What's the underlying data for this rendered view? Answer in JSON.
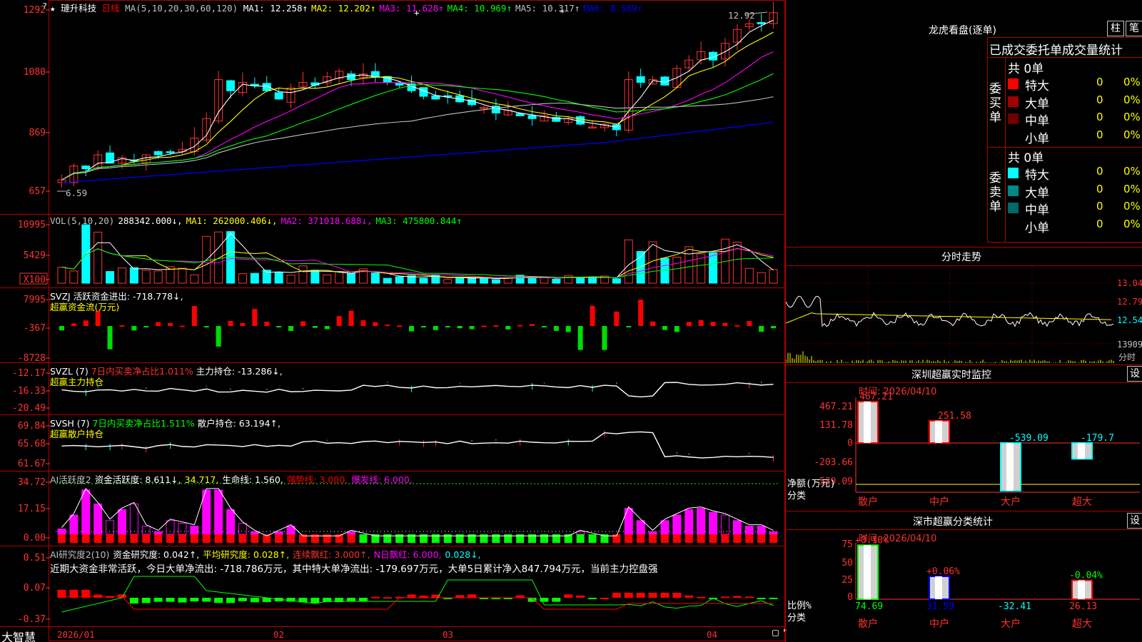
{
  "stock": {
    "star": "★",
    "name": "璉升科技",
    "period": "日线"
  },
  "main_header": {
    "ma_params": "MA(5,10,20,30,60,120)",
    "items": [
      {
        "label": "MA1: 12.258",
        "arrow": "↑",
        "color": "#ffffff"
      },
      {
        "label": "MA2: 12.202",
        "arrow": "↑",
        "color": "#ffff00"
      },
      {
        "label": "MA3: 11.628",
        "arrow": "↑",
        "color": "#ff00ff"
      },
      {
        "label": "MA4: 10.969",
        "arrow": "↑",
        "color": "#00ff00"
      },
      {
        "label": "MA5: 10.317",
        "arrow": "↑",
        "color": "#c0c0c0"
      },
      {
        "label": "MA6: 8.569",
        "arrow": "↑",
        "color": "#0000ff"
      }
    ],
    "high_note": "12.92",
    "low_note": "6.59",
    "plus_mark": "+",
    "star_mark": "*"
  },
  "axes": {
    "price": [
      "1292",
      "1080",
      "869",
      "657"
    ],
    "vol": [
      "10995",
      "5429",
      "X100"
    ],
    "svzj": [
      "7995",
      "-367",
      "-8728"
    ],
    "svzl": [
      "-12.17",
      "-16.33",
      "-20.49"
    ],
    "svsh": [
      "69.84",
      "65.68",
      "61.67"
    ],
    "ai1": [
      "34.72",
      "17.15",
      "0.00"
    ],
    "ai2": [
      "0.51",
      "0.07",
      "-0.37"
    ]
  },
  "vol_header": [
    {
      "label": "VOL(5,10,20)",
      "color": "#c0c0c0"
    },
    {
      "label": "288342.000↓,",
      "color": "#ffffff"
    },
    {
      "label": "MA1: 262000.406↓,",
      "color": "#ffff00"
    },
    {
      "label": "MA2: 371018.688↓,",
      "color": "#ff00ff"
    },
    {
      "label": "MA3: 475800.844↑",
      "color": "#00ff00"
    }
  ],
  "svzj_header": {
    "line1": "SVZJ  活跃资金进出: -718.778↓,",
    "line2": "超赢资金流(万元)"
  },
  "svzl_header": {
    "prefix": "SVZL (7)",
    "mid": "7日内买卖净占比1.011%",
    "suffix": "主力持仓: -13.286↓,",
    "line2": "超赢主力持仓"
  },
  "svsh_header": {
    "prefix": "SVSH (7)",
    "mid": "7日内买卖净占比1.511%",
    "suffix": "散户持仓: 63.194↑,",
    "line2": "超赢散户持仓"
  },
  "ai1_header": [
    {
      "label": "AI活跃度2",
      "color": "#c0c0c0"
    },
    {
      "label": "资金活跃度: 8.611↓,",
      "color": "#ffffff"
    },
    {
      "label": "34.717,",
      "color": "#ffff00"
    },
    {
      "label": "生命线: 1.560,",
      "color": "#ffffff"
    },
    {
      "label": "强势线: 3.000,",
      "color": "#ff0000"
    },
    {
      "label": "爆发线: 6.000,",
      "color": "#ff00ff"
    }
  ],
  "ai2_header": [
    {
      "label": "AI研究度2(10)",
      "color": "#c0c0c0"
    },
    {
      "label": "资金研究度: 0.042↑,",
      "color": "#ffffff"
    },
    {
      "label": "平均研究度: 0.028↑,",
      "color": "#ffff00"
    },
    {
      "label": "连续飘红: 3.000↑,",
      "color": "#ff3030"
    },
    {
      "label": "N日飘红: 6.000,",
      "color": "#ff00ff"
    },
    {
      "label": "0.028↓,",
      "color": "#00ffff"
    }
  ],
  "ai2_comment": "近期大资金非常活跃，今日大单净流出: -718.786万元，其中特大单净流出: -179.697万元，大单5日累计净入847.794万元，当前主力控盘强",
  "date_axis": {
    "brand": "大智慧",
    "labels": [
      "2026/01",
      "02",
      "03",
      "04"
    ]
  },
  "right": {
    "title": "龙虎看盘(逐单)",
    "tab1": "柱",
    "tab2": "笔",
    "stats_title": "已成交委托单成交量统计",
    "buy_side_label": "委买单",
    "sell_side_label": "委卖单",
    "buy": {
      "total": "共 0单",
      "rows": [
        {
          "label": "特大",
          "count": "0",
          "pct": "0%",
          "color": "#ff0000"
        },
        {
          "label": "大单",
          "count": "0",
          "pct": "0%",
          "color": "#a00000"
        },
        {
          "label": "中单",
          "count": "0",
          "pct": "0%",
          "color": "#700000"
        },
        {
          "label": "小单",
          "count": "0",
          "pct": "0%",
          "color": ""
        }
      ]
    },
    "sell": {
      "total": "共 0单",
      "rows": [
        {
          "label": "特大",
          "count": "0",
          "pct": "0%",
          "color": "#00ffff"
        },
        {
          "label": "大单",
          "count": "0",
          "pct": "0%",
          "color": "#008888"
        },
        {
          "label": "中单",
          "count": "0",
          "pct": "0%",
          "color": "#006868"
        },
        {
          "label": "小单",
          "count": "0",
          "pct": "0%",
          "color": ""
        }
      ]
    },
    "intraday_title": "分时走势",
    "intraday_axis": [
      "13.04",
      "12.79",
      "12.54",
      "13909",
      "分时"
    ],
    "monitor_title": "深圳超赢实时监控",
    "monitor_btn": "设",
    "monitor_date": "时间: 2026/04/10",
    "monitor_axis": [
      "467.21",
      "131.78",
      "0",
      "-203.66",
      "-539.09"
    ],
    "monitor_values": [
      "467.21",
      "251.58",
      "-539.09",
      "-179.7"
    ],
    "monitor_unit": "净额(万元)",
    "monitor_category_label": "分类",
    "categories": [
      "散户",
      "中户",
      "大户",
      "超大"
    ],
    "classify_title": "深市超赢分类统计",
    "classify_btn": "设",
    "classify_date": "时间: 2026/04/10",
    "classify_axis": [
      "75",
      "50",
      "25",
      "0"
    ],
    "classify_top": [
      "+0.10%",
      "+0.06%",
      "",
      "-0.04%"
    ],
    "classify_bottom": [
      "74.69",
      "31.59",
      "-32.41",
      "26.13"
    ],
    "classify_ratio_label": "比例%",
    "classify_category_label": "分类"
  },
  "colors": {
    "up": "#ff3232",
    "down": "#00ffff",
    "grid": "#b00000",
    "axis_text": "#ff3232"
  }
}
